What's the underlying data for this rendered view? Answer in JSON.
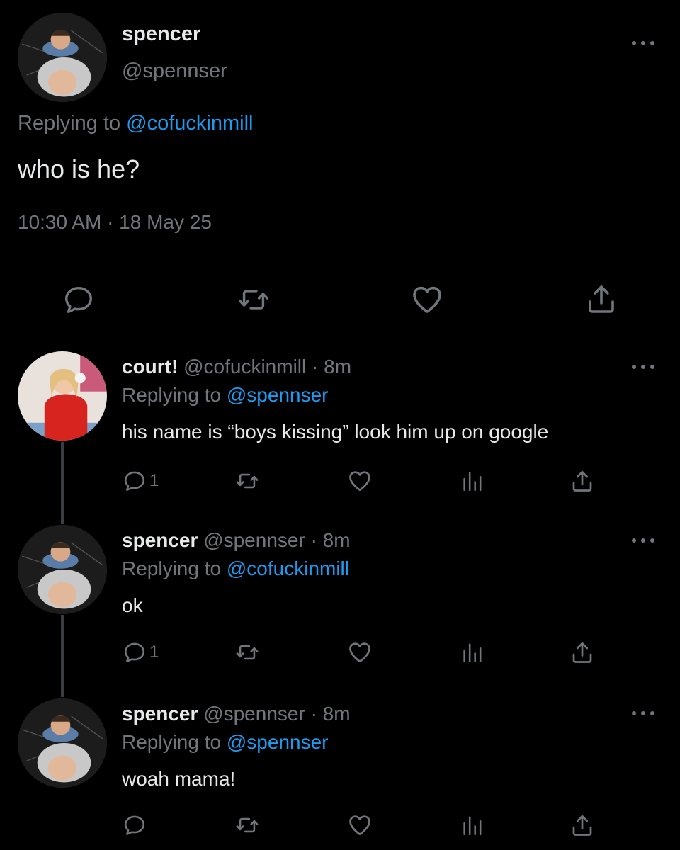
{
  "main_tweet": {
    "display_name": "spencer",
    "handle": "@spennser",
    "replying_prefix": "Replying to ",
    "replying_to": "@cofuckinmill",
    "text": "who is he?",
    "timestamp": "10:30 AM · 18 May 25",
    "actions": [
      "reply-icon",
      "retweet-icon",
      "like-icon",
      "share-icon"
    ]
  },
  "replies": [
    {
      "display_name": "court!",
      "handle_time": "@cofuckinmill · 8m",
      "replying_prefix": "Replying to ",
      "replying_to": "@spennser",
      "text": "his name is “boys kissing” look him up on google",
      "reply_count": "1"
    },
    {
      "display_name": "spencer",
      "handle_time": "@spennser · 8m",
      "replying_prefix": "Replying to ",
      "replying_to": "@cofuckinmill",
      "text": "ok",
      "reply_count": "1"
    },
    {
      "display_name": "spencer",
      "handle_time": "@spennser · 8m",
      "replying_prefix": "Replying to ",
      "replying_to": "@spennser",
      "text": "woah mama!",
      "reply_count": ""
    }
  ],
  "colors": {
    "background": "#000000",
    "text": "#e7e9ea",
    "muted": "#71767b",
    "link": "#1d9bf0",
    "divider": "#2f3336"
  }
}
